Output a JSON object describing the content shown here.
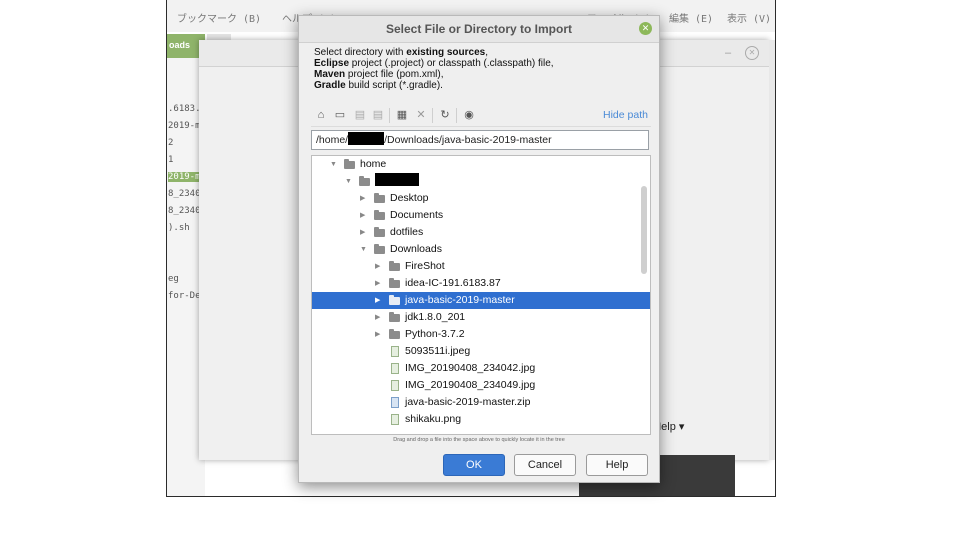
{
  "background": {
    "menu_items": [
      "ブックマーク (B)",
      "ヘルプ (H)",
      "ファイル (F)",
      "編集 (E)",
      "表示 (V)"
    ],
    "tab_label": "oads",
    "side_lines": [
      ".6183.",
      "2019-m",
      "2",
      "1",
      "2019-m",
      "8_2340",
      "8_2340",
      ").sh",
      "",
      "",
      "eg",
      "for-De"
    ],
    "bottom_right": "re ▾   Get Help ▾"
  },
  "dialog": {
    "title": "Select File or Directory to Import",
    "desc_lines": [
      {
        "bold": "",
        "pre": "Select directory with ",
        "b2": "existing sources",
        "post": ","
      },
      {
        "pre": "",
        "b2": "Eclipse",
        "post": " project (.project) or classpath (.classpath) file,"
      },
      {
        "pre": "",
        "b2": "Maven",
        "post": " project file (pom.xml),"
      },
      {
        "pre": "",
        "b2": "Gradle",
        "post": " build script (*.gradle)."
      }
    ],
    "hide_path": "Hide path",
    "path_prefix": "/home/",
    "path_suffix": "/Downloads/java-basic-2019-master",
    "tree": [
      {
        "label": "home",
        "type": "folder",
        "expanded": true,
        "depth": 0
      },
      {
        "label": "",
        "type": "folder",
        "expanded": true,
        "depth": 1,
        "redacted": true
      },
      {
        "label": "Desktop",
        "type": "folder",
        "expanded": false,
        "depth": 2
      },
      {
        "label": "Documents",
        "type": "folder",
        "expanded": false,
        "depth": 2
      },
      {
        "label": "dotfiles",
        "type": "folder",
        "expanded": false,
        "depth": 2
      },
      {
        "label": "Downloads",
        "type": "folder",
        "expanded": true,
        "depth": 2
      },
      {
        "label": "FireShot",
        "type": "folder",
        "expanded": false,
        "depth": 3
      },
      {
        "label": "idea-IC-191.6183.87",
        "type": "folder",
        "expanded": false,
        "depth": 3
      },
      {
        "label": "java-basic-2019-master",
        "type": "folder",
        "expanded": false,
        "depth": 3,
        "selected": true
      },
      {
        "label": "jdk1.8.0_201",
        "type": "folder",
        "expanded": false,
        "depth": 3
      },
      {
        "label": "Python-3.7.2",
        "type": "folder",
        "expanded": false,
        "depth": 3
      },
      {
        "label": "5093511i.jpeg",
        "type": "image",
        "depth": 3
      },
      {
        "label": "IMG_20190408_234042.jpg",
        "type": "image",
        "depth": 3
      },
      {
        "label": "IMG_20190408_234049.jpg",
        "type": "image",
        "depth": 3
      },
      {
        "label": "java-basic-2019-master.zip",
        "type": "zip",
        "depth": 3
      },
      {
        "label": "shikaku.png",
        "type": "image",
        "depth": 3
      }
    ],
    "hint": "Drag and drop a file into the space above to quickly locate it in the tree",
    "buttons": {
      "ok": "OK",
      "cancel": "Cancel",
      "help": "Help"
    },
    "colors": {
      "accent": "#3a7bd5",
      "selection": "#2f6fd0",
      "link": "#4a8ad6",
      "close": "#8db85a"
    }
  }
}
